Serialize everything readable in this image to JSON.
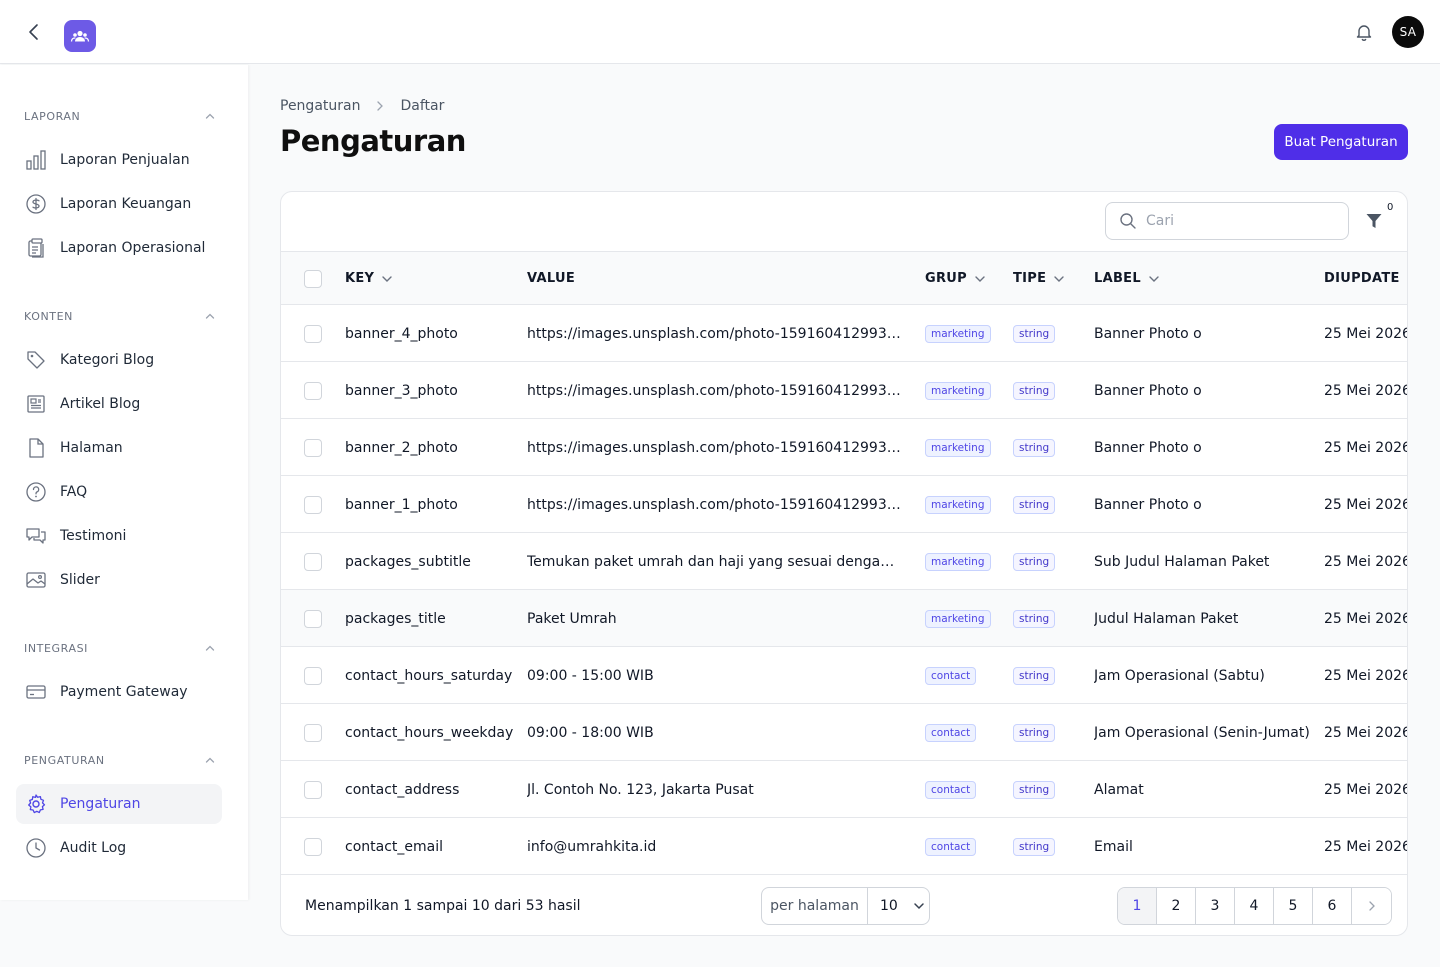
{
  "topbar": {
    "avatar_initials": "SA",
    "brand_color": "#6d5ae6"
  },
  "sidebar": {
    "sections": [
      {
        "title": "LAPORAN",
        "items": [
          {
            "label": "Laporan Penjualan",
            "icon": "bar-chart-icon"
          },
          {
            "label": "Laporan Keuangan",
            "icon": "dollar-circle-icon"
          },
          {
            "label": "Laporan Operasional",
            "icon": "clipboard-icon"
          }
        ]
      },
      {
        "title": "KONTEN",
        "items": [
          {
            "label": "Kategori Blog",
            "icon": "tag-icon"
          },
          {
            "label": "Artikel Blog",
            "icon": "newspaper-icon"
          },
          {
            "label": "Halaman",
            "icon": "document-icon"
          },
          {
            "label": "FAQ",
            "icon": "question-circle-icon"
          },
          {
            "label": "Testimoni",
            "icon": "chat-bubbles-icon"
          },
          {
            "label": "Slider",
            "icon": "image-icon"
          }
        ]
      },
      {
        "title": "INTEGRASI",
        "items": [
          {
            "label": "Payment Gateway",
            "icon": "credit-card-icon"
          }
        ]
      },
      {
        "title": "PENGATURAN",
        "items": [
          {
            "label": "Pengaturan",
            "icon": "gear-icon",
            "active": true
          },
          {
            "label": "Audit Log",
            "icon": "clock-icon"
          }
        ]
      }
    ]
  },
  "breadcrumb": {
    "items": [
      "Pengaturan",
      "Daftar"
    ]
  },
  "page": {
    "title": "Pengaturan",
    "create_button": "Buat Pengaturan",
    "accent_color": "#4f2ee8"
  },
  "table": {
    "search_placeholder": "Cari",
    "filter_count": "0",
    "columns": {
      "key": "KEY",
      "value": "VALUE",
      "group": "GRUP",
      "type": "TIPE",
      "label": "LABEL",
      "updated": "DIUPDATE"
    },
    "rows": [
      {
        "key": "banner_4_photo",
        "value": "https://images.unsplash.com/photo-1591604129939-f1...",
        "group": "marketing",
        "type": "string",
        "label": "Banner Photo o",
        "updated": "25 Mei 2026"
      },
      {
        "key": "banner_3_photo",
        "value": "https://images.unsplash.com/photo-1591604129939-f1...",
        "group": "marketing",
        "type": "string",
        "label": "Banner Photo o",
        "updated": "25 Mei 2026"
      },
      {
        "key": "banner_2_photo",
        "value": "https://images.unsplash.com/photo-1591604129939-f1...",
        "group": "marketing",
        "type": "string",
        "label": "Banner Photo o",
        "updated": "25 Mei 2026"
      },
      {
        "key": "banner_1_photo",
        "value": "https://images.unsplash.com/photo-1591604129939-f1...",
        "group": "marketing",
        "type": "string",
        "label": "Banner Photo o",
        "updated": "25 Mei 2026"
      },
      {
        "key": "packages_subtitle",
        "value": "Temukan paket umrah dan haji yang sesuai dengan ke...",
        "group": "marketing",
        "type": "string",
        "label": "Sub Judul Halaman Paket",
        "updated": "25 Mei 2026"
      },
      {
        "key": "packages_title",
        "value": "Paket Umrah",
        "group": "marketing",
        "type": "string",
        "label": "Judul Halaman Paket",
        "updated": "25 Mei 2026"
      },
      {
        "key": "contact_hours_saturday",
        "value": "09:00 - 15:00 WIB",
        "group": "contact",
        "type": "string",
        "label": "Jam Operasional (Sabtu)",
        "updated": "25 Mei 2026"
      },
      {
        "key": "contact_hours_weekday",
        "value": "09:00 - 18:00 WIB",
        "group": "contact",
        "type": "string",
        "label": "Jam Operasional (Senin-Jumat)",
        "updated": "25 Mei 2026"
      },
      {
        "key": "contact_address",
        "value": "Jl. Contoh No. 123, Jakarta Pusat",
        "group": "contact",
        "type": "string",
        "label": "Alamat",
        "updated": "25 Mei 2026"
      },
      {
        "key": "contact_email",
        "value": "info@umrahkita.id",
        "group": "contact",
        "type": "string",
        "label": "Email",
        "updated": "25 Mei 2026"
      }
    ]
  },
  "footer": {
    "summary": "Menampilkan 1 sampai 10 dari 53 hasil",
    "per_page_label": "per halaman",
    "per_page_value": "10",
    "pages": [
      "1",
      "2",
      "3",
      "4",
      "5",
      "6"
    ],
    "current_page": "1"
  }
}
